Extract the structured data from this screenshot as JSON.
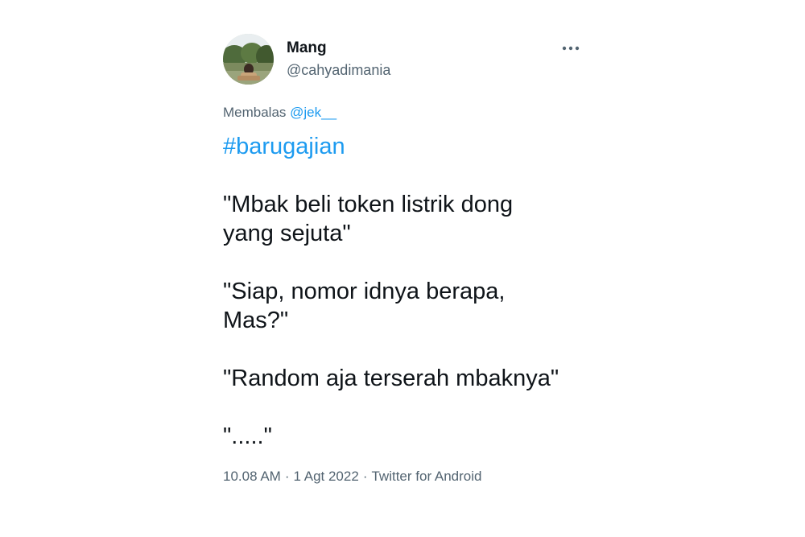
{
  "author": {
    "display_name": "Mang",
    "handle": "@cahyadimania"
  },
  "more_icon": "more-horizontal-icon",
  "reply": {
    "prefix": "Membalas ",
    "mention": "@jek__"
  },
  "tweet": {
    "hashtag": "#barugajian",
    "lines": [
      "\"Mbak beli token listrik dong",
      "yang sejuta\"",
      "\"Siap, nomor idnya berapa,",
      "Mas?\"",
      "\"Random aja terserah mbaknya\"",
      "\".....\""
    ]
  },
  "meta": {
    "time": "10.08 AM",
    "separator": "·",
    "date": "1 Agt 2022",
    "source": "Twitter for Android"
  },
  "colors": {
    "link": "#1d9bf0",
    "secondary_text": "#536471",
    "primary_text": "#0f1419"
  }
}
